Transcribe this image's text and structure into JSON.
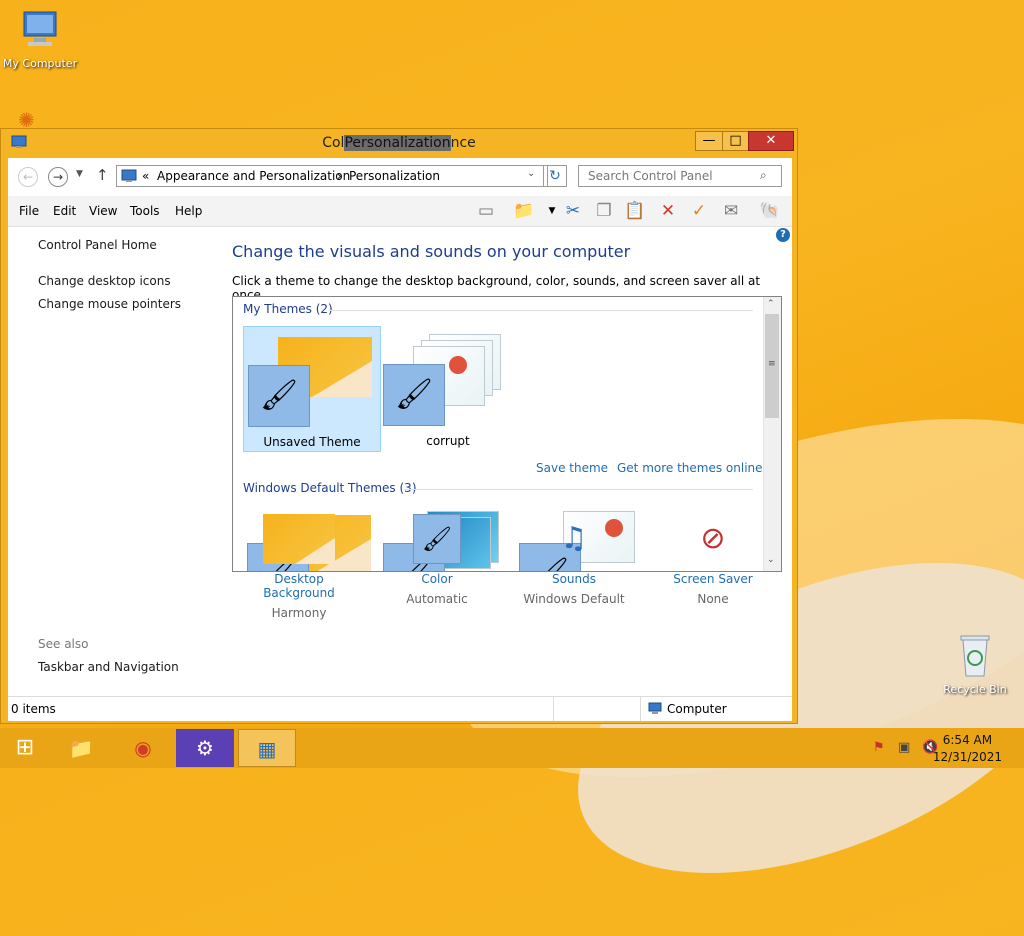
{
  "desktop": {
    "icons": [
      {
        "label": "My Computer"
      },
      {
        "label": "Recycle Bin"
      }
    ]
  },
  "window": {
    "title_left": "Col",
    "title_highlight": "Personalization",
    "title_right": "nce",
    "controls": {
      "minimize": "—",
      "maximize": "□",
      "close": "✕"
    }
  },
  "address": {
    "breadcrumb_prefix": "«",
    "crumb1": "Appearance and Personalization",
    "separator": "›",
    "crumb2": "Personalization",
    "search_placeholder": "Search Control Panel"
  },
  "menu": {
    "items": [
      "File",
      "Edit",
      "View",
      "Tools",
      "Help"
    ]
  },
  "sidebar": {
    "home": "Control Panel Home",
    "links": [
      "Change desktop icons",
      "Change mouse pointers"
    ],
    "see_also_title": "See also",
    "see_also_links": [
      "Taskbar and Navigation"
    ]
  },
  "main": {
    "heading": "Change the visuals and sounds on your computer",
    "subheading": "Click a theme to change the desktop background, color, sounds, and screen saver all at once.",
    "my_themes_title": "My Themes (2)",
    "my_themes": [
      {
        "name": "Unsaved Theme",
        "selected": true
      },
      {
        "name": "corrupt",
        "selected": false
      }
    ],
    "save_theme": "Save theme",
    "get_more": "Get more themes online",
    "default_title": "Windows Default Themes (3)"
  },
  "bottom_settings": [
    {
      "label": "Desktop Background",
      "value": "Harmony"
    },
    {
      "label": "Color",
      "value": "Automatic"
    },
    {
      "label": "Sounds",
      "value": "Windows Default"
    },
    {
      "label": "Screen Saver",
      "value": "None"
    }
  ],
  "statusbar": {
    "items_count": "0 items",
    "location": "Computer"
  },
  "taskbar": {
    "time": "6:54 AM",
    "date": "12/31/2021"
  },
  "colors": {
    "accent_window": "#f4b424",
    "link": "#1f6db3",
    "heading": "#1e3d8f",
    "selection": "#cce8ff",
    "close_button": "#c7372f"
  }
}
